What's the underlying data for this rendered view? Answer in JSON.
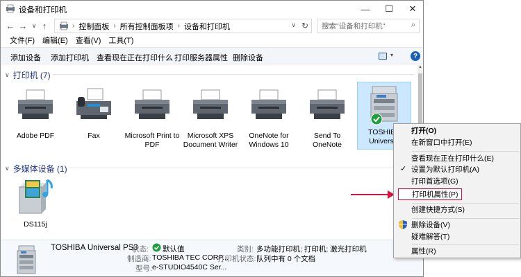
{
  "window": {
    "title": "设备和打印机",
    "minimize": "—",
    "maximize": "☐",
    "close": "✕"
  },
  "nav": {
    "back": "←",
    "forward": "→",
    "recent": "∨",
    "up": "↑",
    "breadcrumbs": [
      "控制面板",
      "所有控制面板项",
      "设备和打印机"
    ],
    "separator": "›",
    "refresh": "↻",
    "dropdown": "∨",
    "search_placeholder": "搜索\"设备和打印机\"",
    "search_icon": "⌕"
  },
  "menubar": [
    "文件(F)",
    "编辑(E)",
    "查看(V)",
    "工具(T)"
  ],
  "commands": [
    "添加设备",
    "添加打印机",
    "查看现在正在打印什么",
    "打印服务器属性",
    "删除设备"
  ],
  "toolbar": {
    "view_dropdown": "▾",
    "help": "?"
  },
  "printers_group": {
    "header": "打印机 (7)",
    "chevron": "∨",
    "devices": [
      {
        "label": "Adobe PDF",
        "icon": "printer-icon"
      },
      {
        "label": "Fax",
        "icon": "fax-icon"
      },
      {
        "label": "Microsoft Print to PDF",
        "icon": "printer-icon"
      },
      {
        "label": "Microsoft XPS Document Writer",
        "icon": "printer-icon"
      },
      {
        "label": "OneNote for Windows 10",
        "icon": "printer-icon"
      },
      {
        "label": "Send To OneNote",
        "icon": "printer-icon"
      },
      {
        "label": "TOSHIBA Universal",
        "icon": "copier-icon",
        "selected": true,
        "default": true
      }
    ]
  },
  "media_group": {
    "header": "多媒体设备 (1)",
    "chevron": "∨",
    "devices": [
      {
        "label": "DS115j",
        "icon": "media-server-icon"
      }
    ]
  },
  "details": {
    "name": "TOSHIBA Universal PS3",
    "status_key": "状态:",
    "status_value": "默认值",
    "manufacturer_key": "制造商:",
    "manufacturer_value": "TOSHIBA TEC CORP...",
    "model_key": "型号:",
    "model_value": "e-STUDIO4540C Ser...",
    "category_key": "类别:",
    "category_value": "多功能打印机; 打印机; 激光打印机",
    "printer_status_key": "打印机状态:",
    "printer_status_value": "队列中有 0 个文档"
  },
  "context_menu": {
    "items": [
      {
        "label": "打开(O)",
        "bold": true
      },
      {
        "label": "在新窗口中打开(E)"
      },
      {
        "label": "查看现在正在打印什么(E)"
      },
      {
        "label": "设置为默认打印机(A)",
        "checked": true,
        "check": "✓"
      },
      {
        "label": "打印首选项(G)"
      },
      {
        "label": "打印机属性(P)",
        "highlighted": true
      },
      {
        "label": "创建快捷方式(S)"
      },
      {
        "label": "删除设备(V)",
        "shield": true
      },
      {
        "label": "疑难解答(T)"
      },
      {
        "label": "属性(R)"
      }
    ]
  },
  "colors": {
    "accent": "#1e3287",
    "highlight_border": "#e0103c",
    "arrow": "#d9123e",
    "selection": "#cce8ff"
  }
}
